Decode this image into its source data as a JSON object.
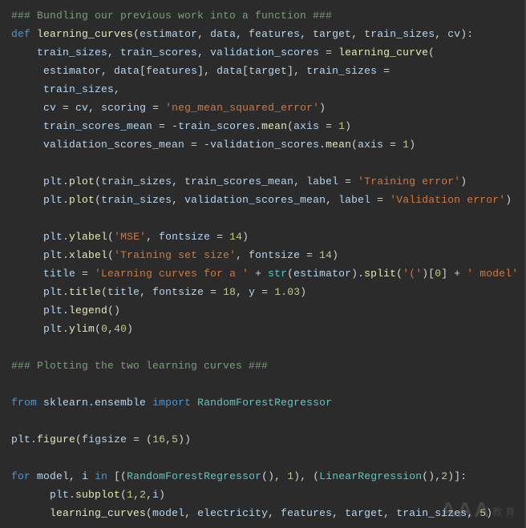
{
  "code": {
    "tokens": [
      [
        [
          "c-cm",
          "### Bundling our previous work into a function ###"
        ]
      ],
      [
        [
          "c-kw",
          "def"
        ],
        [
          "c-wh",
          " "
        ],
        [
          "c-fn",
          "learning_curves"
        ],
        [
          "c-op",
          "("
        ],
        [
          "c-id",
          "estimator"
        ],
        [
          "c-op",
          ", "
        ],
        [
          "c-id",
          "data"
        ],
        [
          "c-op",
          ", "
        ],
        [
          "c-id",
          "features"
        ],
        [
          "c-op",
          ", "
        ],
        [
          "c-id",
          "target"
        ],
        [
          "c-op",
          ", "
        ],
        [
          "c-id",
          "train_sizes"
        ],
        [
          "c-op",
          ", "
        ],
        [
          "c-id",
          "cv"
        ],
        [
          "c-op",
          "):"
        ]
      ],
      [
        [
          "c-wh",
          "    "
        ],
        [
          "c-id",
          "train_sizes"
        ],
        [
          "c-op",
          ", "
        ],
        [
          "c-id",
          "train_scores"
        ],
        [
          "c-op",
          ", "
        ],
        [
          "c-id",
          "validation_scores"
        ],
        [
          "c-op",
          " = "
        ],
        [
          "c-fn",
          "learning_curve"
        ],
        [
          "c-op",
          "("
        ]
      ],
      [
        [
          "c-wh",
          "     "
        ],
        [
          "c-id",
          "estimator"
        ],
        [
          "c-op",
          ", "
        ],
        [
          "c-id",
          "data"
        ],
        [
          "c-op",
          "["
        ],
        [
          "c-id",
          "features"
        ],
        [
          "c-op",
          "], "
        ],
        [
          "c-id",
          "data"
        ],
        [
          "c-op",
          "["
        ],
        [
          "c-id",
          "target"
        ],
        [
          "c-op",
          "], "
        ],
        [
          "c-id",
          "train_sizes"
        ],
        [
          "c-op",
          " ="
        ]
      ],
      [
        [
          "c-wh",
          "     "
        ],
        [
          "c-id",
          "train_sizes"
        ],
        [
          "c-op",
          ","
        ]
      ],
      [
        [
          "c-wh",
          "     "
        ],
        [
          "c-id",
          "cv"
        ],
        [
          "c-op",
          " = "
        ],
        [
          "c-id",
          "cv"
        ],
        [
          "c-op",
          ", "
        ],
        [
          "c-id",
          "scoring"
        ],
        [
          "c-op",
          " = "
        ],
        [
          "c-str",
          "'neg_mean_squared_error'"
        ],
        [
          "c-op",
          ")"
        ]
      ],
      [
        [
          "c-wh",
          "     "
        ],
        [
          "c-id",
          "train_scores_mean"
        ],
        [
          "c-op",
          " = -"
        ],
        [
          "c-id",
          "train_scores"
        ],
        [
          "c-op",
          "."
        ],
        [
          "c-fn",
          "mean"
        ],
        [
          "c-op",
          "("
        ],
        [
          "c-id",
          "axis"
        ],
        [
          "c-op",
          " = "
        ],
        [
          "c-num",
          "1"
        ],
        [
          "c-op",
          ")"
        ]
      ],
      [
        [
          "c-wh",
          "     "
        ],
        [
          "c-id",
          "validation_scores_mean"
        ],
        [
          "c-op",
          " = -"
        ],
        [
          "c-id",
          "validation_scores"
        ],
        [
          "c-op",
          "."
        ],
        [
          "c-fn",
          "mean"
        ],
        [
          "c-op",
          "("
        ],
        [
          "c-id",
          "axis"
        ],
        [
          "c-op",
          " = "
        ],
        [
          "c-num",
          "1"
        ],
        [
          "c-op",
          ")"
        ]
      ],
      [
        [
          "c-wh",
          " "
        ]
      ],
      [
        [
          "c-wh",
          "     "
        ],
        [
          "c-id",
          "plt"
        ],
        [
          "c-op",
          "."
        ],
        [
          "c-fn",
          "plot"
        ],
        [
          "c-op",
          "("
        ],
        [
          "c-id",
          "train_sizes"
        ],
        [
          "c-op",
          ", "
        ],
        [
          "c-id",
          "train_scores_mean"
        ],
        [
          "c-op",
          ", "
        ],
        [
          "c-id",
          "label"
        ],
        [
          "c-op",
          " = "
        ],
        [
          "c-str",
          "'Training error'"
        ],
        [
          "c-op",
          ")"
        ]
      ],
      [
        [
          "c-wh",
          "     "
        ],
        [
          "c-id",
          "plt"
        ],
        [
          "c-op",
          "."
        ],
        [
          "c-fn",
          "plot"
        ],
        [
          "c-op",
          "("
        ],
        [
          "c-id",
          "train_sizes"
        ],
        [
          "c-op",
          ", "
        ],
        [
          "c-id",
          "validation_scores_mean"
        ],
        [
          "c-op",
          ", "
        ],
        [
          "c-id",
          "label"
        ],
        [
          "c-op",
          " = "
        ],
        [
          "c-str",
          "'Validation error'"
        ],
        [
          "c-op",
          ")"
        ]
      ],
      [
        [
          "c-wh",
          " "
        ]
      ],
      [
        [
          "c-wh",
          "     "
        ],
        [
          "c-id",
          "plt"
        ],
        [
          "c-op",
          "."
        ],
        [
          "c-fn",
          "ylabel"
        ],
        [
          "c-op",
          "("
        ],
        [
          "c-str",
          "'MSE'"
        ],
        [
          "c-op",
          ", "
        ],
        [
          "c-id",
          "fontsize"
        ],
        [
          "c-op",
          " = "
        ],
        [
          "c-num",
          "14"
        ],
        [
          "c-op",
          ")"
        ]
      ],
      [
        [
          "c-wh",
          "     "
        ],
        [
          "c-id",
          "plt"
        ],
        [
          "c-op",
          "."
        ],
        [
          "c-fn",
          "xlabel"
        ],
        [
          "c-op",
          "("
        ],
        [
          "c-str",
          "'Training set size'"
        ],
        [
          "c-op",
          ", "
        ],
        [
          "c-id",
          "fontsize"
        ],
        [
          "c-op",
          " = "
        ],
        [
          "c-num",
          "14"
        ],
        [
          "c-op",
          ")"
        ]
      ],
      [
        [
          "c-wh",
          "     "
        ],
        [
          "c-id",
          "title"
        ],
        [
          "c-op",
          " = "
        ],
        [
          "c-str",
          "'Learning curves for a '"
        ],
        [
          "c-op",
          " + "
        ],
        [
          "c-cls",
          "str"
        ],
        [
          "c-op",
          "("
        ],
        [
          "c-id",
          "estimator"
        ],
        [
          "c-op",
          ")."
        ],
        [
          "c-fn",
          "split"
        ],
        [
          "c-op",
          "("
        ],
        [
          "c-str",
          "'('"
        ],
        [
          "c-op",
          ")["
        ],
        [
          "c-num",
          "0"
        ],
        [
          "c-op",
          "] + "
        ],
        [
          "c-str",
          "' model'"
        ]
      ],
      [
        [
          "c-wh",
          "     "
        ],
        [
          "c-id",
          "plt"
        ],
        [
          "c-op",
          "."
        ],
        [
          "c-fn",
          "title"
        ],
        [
          "c-op",
          "("
        ],
        [
          "c-id",
          "title"
        ],
        [
          "c-op",
          ", "
        ],
        [
          "c-id",
          "fontsize"
        ],
        [
          "c-op",
          " = "
        ],
        [
          "c-num",
          "18"
        ],
        [
          "c-op",
          ", "
        ],
        [
          "c-id",
          "y"
        ],
        [
          "c-op",
          " = "
        ],
        [
          "c-num",
          "1.03"
        ],
        [
          "c-op",
          ")"
        ]
      ],
      [
        [
          "c-wh",
          "     "
        ],
        [
          "c-id",
          "plt"
        ],
        [
          "c-op",
          "."
        ],
        [
          "c-fn",
          "legend"
        ],
        [
          "c-op",
          "()"
        ]
      ],
      [
        [
          "c-wh",
          "     "
        ],
        [
          "c-id",
          "plt"
        ],
        [
          "c-op",
          "."
        ],
        [
          "c-fn",
          "ylim"
        ],
        [
          "c-op",
          "("
        ],
        [
          "c-num",
          "0"
        ],
        [
          "c-op",
          ","
        ],
        [
          "c-num",
          "40"
        ],
        [
          "c-op",
          ")"
        ]
      ],
      [
        [
          "c-wh",
          " "
        ]
      ],
      [
        [
          "c-cm",
          "### Plotting the two learning curves ###"
        ]
      ],
      [
        [
          "c-wh",
          " "
        ]
      ],
      [
        [
          "c-kw",
          "from"
        ],
        [
          "c-wh",
          " "
        ],
        [
          "c-id",
          "sklearn.ensemble"
        ],
        [
          "c-wh",
          " "
        ],
        [
          "c-kw",
          "import"
        ],
        [
          "c-wh",
          " "
        ],
        [
          "c-cls",
          "RandomForestRegressor"
        ]
      ],
      [
        [
          "c-wh",
          " "
        ]
      ],
      [
        [
          "c-id",
          "plt"
        ],
        [
          "c-op",
          "."
        ],
        [
          "c-fn",
          "figure"
        ],
        [
          "c-op",
          "("
        ],
        [
          "c-id",
          "figsize"
        ],
        [
          "c-op",
          " = ("
        ],
        [
          "c-num",
          "16"
        ],
        [
          "c-op",
          ","
        ],
        [
          "c-num",
          "5"
        ],
        [
          "c-op",
          "))"
        ]
      ],
      [
        [
          "c-wh",
          " "
        ]
      ],
      [
        [
          "c-kw",
          "for"
        ],
        [
          "c-wh",
          " "
        ],
        [
          "c-id",
          "model"
        ],
        [
          "c-op",
          ", "
        ],
        [
          "c-id",
          "i"
        ],
        [
          "c-wh",
          " "
        ],
        [
          "c-kw",
          "in"
        ],
        [
          "c-wh",
          " "
        ],
        [
          "c-op",
          "[("
        ],
        [
          "c-cls",
          "RandomForestRegressor"
        ],
        [
          "c-op",
          "(), "
        ],
        [
          "c-num",
          "1"
        ],
        [
          "c-op",
          "), ("
        ],
        [
          "c-cls",
          "LinearRegression"
        ],
        [
          "c-op",
          "(),"
        ],
        [
          "c-num",
          "2"
        ],
        [
          "c-op",
          ")]:"
        ]
      ],
      [
        [
          "c-wh",
          "      "
        ],
        [
          "c-id",
          "plt"
        ],
        [
          "c-op",
          "."
        ],
        [
          "c-fn",
          "subplot"
        ],
        [
          "c-op",
          "("
        ],
        [
          "c-num",
          "1"
        ],
        [
          "c-op",
          ","
        ],
        [
          "c-num",
          "2"
        ],
        [
          "c-op",
          ","
        ],
        [
          "c-id",
          "i"
        ],
        [
          "c-op",
          ")"
        ]
      ],
      [
        [
          "c-wh",
          "      "
        ],
        [
          "c-fn",
          "learning_curves"
        ],
        [
          "c-op",
          "("
        ],
        [
          "c-id",
          "model"
        ],
        [
          "c-op",
          ", "
        ],
        [
          "c-id",
          "electricity"
        ],
        [
          "c-op",
          ", "
        ],
        [
          "c-id",
          "features"
        ],
        [
          "c-op",
          ", "
        ],
        [
          "c-id",
          "target"
        ],
        [
          "c-op",
          ", "
        ],
        [
          "c-id",
          "train_sizes"
        ],
        [
          "c-op",
          ", "
        ],
        [
          "c-num",
          "5"
        ],
        [
          "c-op",
          ")"
        ]
      ]
    ]
  },
  "watermark": {
    "main": "AAA",
    "sub": "教育"
  }
}
